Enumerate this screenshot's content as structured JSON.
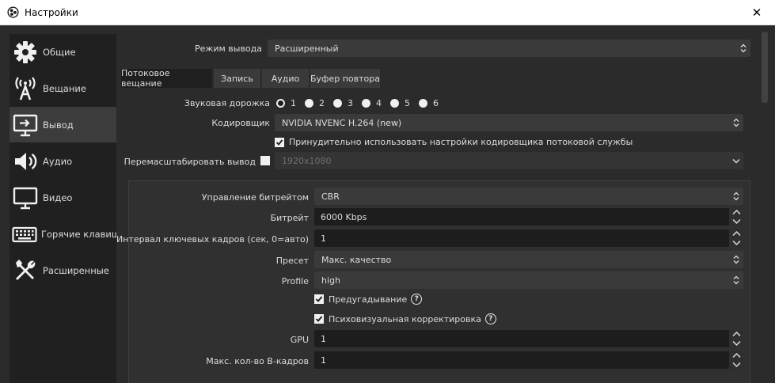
{
  "window": {
    "title": "Настройки",
    "close_glyph": "✕"
  },
  "sidebar": {
    "items": [
      {
        "label": "Общие",
        "icon": "gear-icon",
        "active": false
      },
      {
        "label": "Вещание",
        "icon": "broadcast-tower-icon",
        "active": false
      },
      {
        "label": "Вывод",
        "icon": "output-monitor-icon",
        "active": true
      },
      {
        "label": "Аудио",
        "icon": "speaker-icon",
        "active": false
      },
      {
        "label": "Видео",
        "icon": "display-icon",
        "active": false
      },
      {
        "label": "Горячие клавиши",
        "icon": "keyboard-icon",
        "active": false
      },
      {
        "label": "Расширенные",
        "icon": "tools-icon",
        "active": false
      }
    ]
  },
  "output_mode": {
    "label": "Режим вывода",
    "value": "Расширенный"
  },
  "tabs": [
    {
      "label": "Потоковое вещание",
      "active": true
    },
    {
      "label": "Запись",
      "active": false
    },
    {
      "label": "Аудио",
      "active": false
    },
    {
      "label": "Буфер повтора",
      "active": false
    }
  ],
  "audio_track": {
    "label": "Звуковая дорожка",
    "options": [
      "1",
      "2",
      "3",
      "4",
      "5",
      "6"
    ],
    "selected": "1"
  },
  "encoder": {
    "label": "Кодировщик",
    "value": "NVIDIA NVENC H.264 (new)"
  },
  "enforce_service_settings": {
    "label": "Принудительно использовать настройки кодировщика потоковой службы",
    "checked": true
  },
  "rescale": {
    "label": "Перемасштабировать вывод",
    "checked": false,
    "value": "1920x1080"
  },
  "encoder_settings": {
    "rate_control": {
      "label": "Управление битрейтом",
      "value": "CBR"
    },
    "bitrate": {
      "label": "Битрейт",
      "value": "6000 Kbps"
    },
    "keyframe_interval": {
      "label": "Интервал ключевых кадров (сек, 0=авто)",
      "value": "1"
    },
    "preset": {
      "label": "Пресет",
      "value": "Макс. качество"
    },
    "profile": {
      "label": "Profile",
      "value": "high"
    },
    "lookahead": {
      "label": "Предугадывание",
      "checked": true,
      "help": "?"
    },
    "psycho_visual": {
      "label": "Психовизуальная корректировка",
      "checked": true,
      "help": "?"
    },
    "gpu": {
      "label": "GPU",
      "value": "1"
    },
    "max_b_frames": {
      "label": "Макс. кол-во B-кадров",
      "value": "1"
    }
  }
}
